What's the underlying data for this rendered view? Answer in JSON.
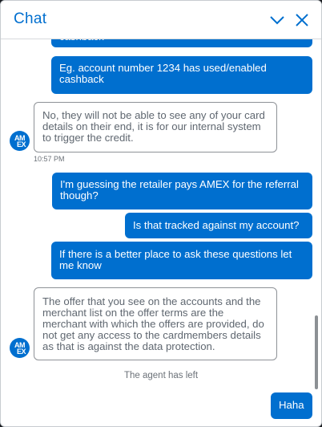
{
  "header": {
    "title": "Chat"
  },
  "icons": {
    "collapse": "chevron-down-icon",
    "close": "close-icon",
    "avatar": "amex-logo"
  },
  "avatar": {
    "line1": "AM",
    "line2": "EX"
  },
  "messages": [
    {
      "role": "user",
      "text": "cashback"
    },
    {
      "role": "user",
      "text": "Eg. account number 1234 has used/enabled cashback"
    },
    {
      "role": "agent",
      "text": "No, they will not be able to see any of your card details on their end, it is for our internal system to trigger the credit.",
      "time": "10:57 PM"
    },
    {
      "role": "user",
      "text": "I'm guessing the retailer pays AMEX for the referral though?"
    },
    {
      "role": "user",
      "text": "Is that tracked against my account?"
    },
    {
      "role": "user",
      "text": "If there is a better place to ask these questions let me know"
    },
    {
      "role": "agent",
      "text": "The offer that you see on the accounts and the merchant list on the offer terms are the merchant with which the offers are provided, do not get any access to the cardmembers details as that is against the data protection."
    },
    {
      "role": "system",
      "text": "The agent has left"
    },
    {
      "role": "user",
      "text": "Haha"
    }
  ],
  "colors": {
    "accent": "#006fcf",
    "agent_text": "#5f6770",
    "agent_border": "#8e9297"
  }
}
